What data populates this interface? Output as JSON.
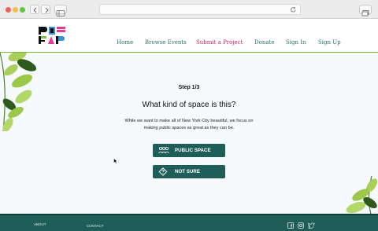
{
  "browser": {
    "url": ""
  },
  "nav": {
    "home": "Home",
    "browse": "Browse Events",
    "submit": "Submit a Project",
    "donate": "Donate",
    "signin": "Sign In",
    "signup": "Sign Up"
  },
  "main": {
    "step": "Step 1/3",
    "question": "What kind of space is this?",
    "description": "While we want to make all of New York City beautiful, we focus on making public spaces as great as they can be.",
    "options": [
      {
        "label": "PUBLIC SPACE",
        "icon": "people-icon"
      },
      {
        "label": "NOT SURE",
        "icon": "question-diamond-icon"
      }
    ]
  },
  "footer": {
    "about": "ABOUT",
    "contact": "CONTACT",
    "social": [
      "facebook-icon",
      "instagram-icon",
      "twitter-icon"
    ]
  },
  "colors": {
    "brand_teal": "#1f5d58",
    "nav_green": "#2f6f66",
    "highlight_pink": "#c4266d",
    "accent_green": "#77b843"
  }
}
